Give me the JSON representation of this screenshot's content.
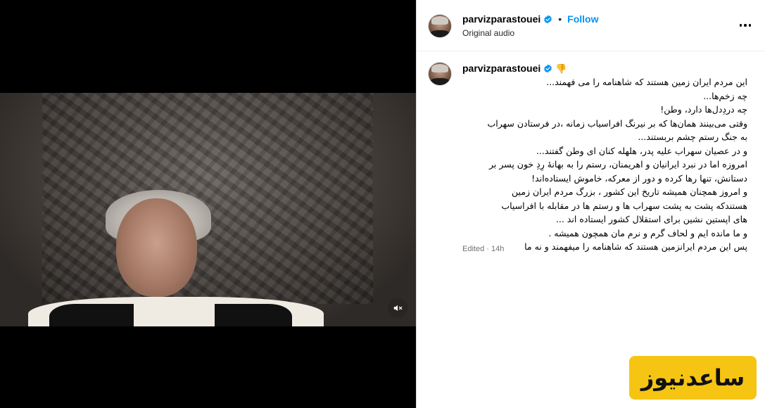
{
  "post": {
    "username": "parvizparastouei",
    "follow_label": "Follow",
    "audio_label": "Original audio",
    "separator": "•"
  },
  "caption": {
    "username": "parvizparastouei",
    "emoji": "👎",
    "lines": [
      "این مردم ایران زمین هستند که شاهنامه را می فهمند...",
      "چه زخم‌ها...",
      "چه دردِدل‌ها دارد، وطن!",
      "وقتی می‌بینند همان‌ها که بر نیرنگ افراسیاب زمانه ،در فرستادن سهراب",
      "به جنگ رستم چشم بربستند...",
      "و در عصیان سهراب علیه پدر، هلهله کنان ای وطن گفتند...",
      "امروزه اما در نبرد ایرانیان و اهریمنان، رستم را به بهانهٔ رِدِ خون پسر بر",
      "دستانش، تنها رها کرده و دور از معرکه، خاموش ایستاده‌اند!",
      "و امروز همچنان همیشه تاریخ این کشور ، بزرگ مردم ایران زمین",
      "هستندکه پشت به پشت سهراب ها و رستم ها در مقابله با افراسیاب",
      "های اپستین نشین برای استقلال کشور ایستاده اند ...",
      "و ما مانده ایم و لحاف گرم و نرم مان همچون همیشه .",
      "پس این مردم ایرانزمین هستند که شاهنامه را میفهمند و نه ما"
    ],
    "edited": "Edited",
    "time": "14h",
    "meta_separator": "·"
  },
  "watermark": {
    "text": "ساعدنیوز"
  },
  "icons": {
    "mute": "speaker-muted-icon",
    "verified": "verified-badge-icon",
    "more": "more-options-icon"
  },
  "colors": {
    "accent": "#0095f6",
    "verified": "#0095f6",
    "watermark_bg": "#f6c413",
    "muted_text": "#737373"
  }
}
